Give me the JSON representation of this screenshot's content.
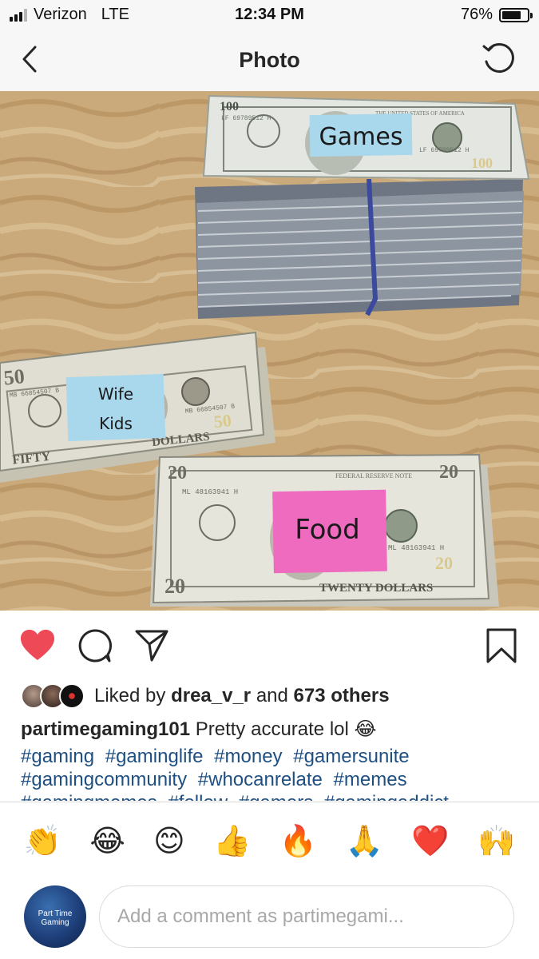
{
  "status_bar": {
    "carrier": "Verizon",
    "network": "LTE",
    "time": "12:34 PM",
    "battery_percent": "76%",
    "battery_level": 0.76,
    "signal_bars": 3
  },
  "nav": {
    "title": "Photo",
    "back_icon": "chevron-left-icon",
    "refresh_icon": "refresh-icon"
  },
  "photo": {
    "stickers": {
      "top": "Games",
      "middle_line1": "Wife",
      "middle_line2": "Kids",
      "bottom": "Food"
    },
    "bill_text": {
      "serial_top": "LF 69789512 H",
      "serial_mid": "MB 66854507 B",
      "serial_bottom": "ML 48163941 H",
      "fifty_bottom": "FIFTY",
      "fifty_dollars": "DOLLARS",
      "twenty_bottom": "TWENTY DOLLARS",
      "num_100": "100",
      "num_50": "50",
      "num_20": "20",
      "usa": "THE UNITED STATES OF AMERICA",
      "note": "FEDERAL RESERVE NOTE"
    }
  },
  "actions": {
    "like_icon": "heart-icon",
    "comment_icon": "comment-icon",
    "share_icon": "send-icon",
    "save_icon": "bookmark-icon",
    "like_color": "#ed4956"
  },
  "likes": {
    "prefix": "Liked by",
    "user": "drea_v_r",
    "middle": "and",
    "others": "673 others"
  },
  "caption": {
    "username": "partimegaming101",
    "text": "Pretty accurate lol",
    "emoji": "😂"
  },
  "hashtags": [
    "#gaming",
    "#gaminglife",
    "#money",
    "#gamersunite",
    "#gamingcommunity",
    "#whocanrelate",
    "#memes",
    "#gamingmemes",
    "#follow",
    "#gamers",
    "#gamingaddict"
  ],
  "emoji_bar": [
    "👏",
    "😂",
    "😊",
    "👍",
    "🔥",
    "🙏",
    "❤️",
    "🙌"
  ],
  "comment": {
    "placeholder": "Add a comment as partimegami...",
    "avatar_text": "Part Time Gaming"
  },
  "colors": {
    "link": "#1e4f82",
    "sticker_blue": "#a9d8ec",
    "sticker_pink": "#ee6bc0",
    "table": "#c9ae82"
  }
}
